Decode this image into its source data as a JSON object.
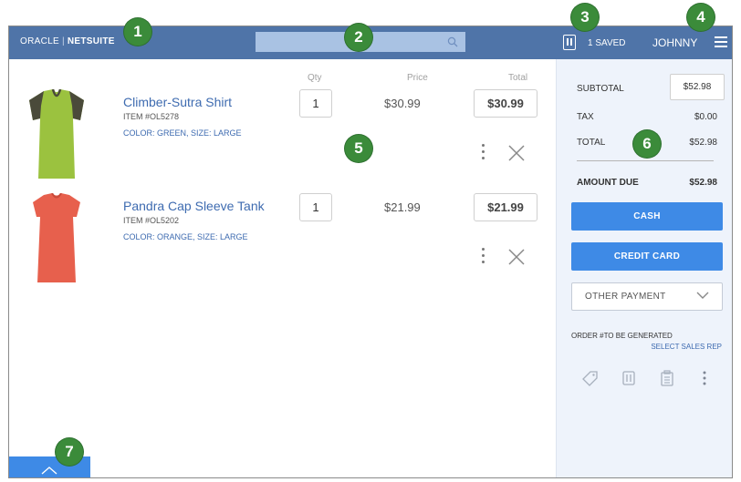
{
  "header": {
    "logo_oracle": "ORACLE",
    "logo_netsuite": "NETSUITE",
    "search_value": "",
    "saved_label": "1 SAVED",
    "username": "JOHNNY"
  },
  "cart": {
    "col_qty": "Qty",
    "col_price": "Price",
    "col_total": "Total",
    "items": [
      {
        "name": "Climber-Sutra Shirt",
        "sku": "ITEM #OL5278",
        "attributes": "COLOR: GREEN, SIZE: LARGE",
        "qty": "1",
        "price": "$30.99",
        "total": "$30.99",
        "color": "#9bc23f"
      },
      {
        "name": "Pandra Cap Sleeve Tank",
        "sku": "ITEM #OL5202",
        "attributes": "COLOR: ORANGE, SIZE: LARGE",
        "qty": "1",
        "price": "$21.99",
        "total": "$21.99",
        "color": "#e7604d"
      }
    ]
  },
  "summary": {
    "subtotal_label": "SUBTOTAL",
    "subtotal_value": "$52.98",
    "tax_label": "TAX",
    "tax_value": "$0.00",
    "total_label": "TOTAL",
    "total_value": "$52.98",
    "amount_due_label": "AMOUNT DUE",
    "amount_due_value": "$52.98",
    "cash_label": "CASH",
    "credit_card_label": "CREDIT CARD",
    "other_payment_label": "OTHER PAYMENT",
    "order_number": "ORDER #TO BE GENERATED",
    "sales_rep_link": "SELECT SALES REP"
  },
  "callouts": [
    "1",
    "2",
    "3",
    "4",
    "5",
    "6",
    "7"
  ],
  "colors": {
    "header": "#4f74a8",
    "accent": "#3e8ae6",
    "callout": "#3b8b3a",
    "link": "#3e6bb0"
  }
}
